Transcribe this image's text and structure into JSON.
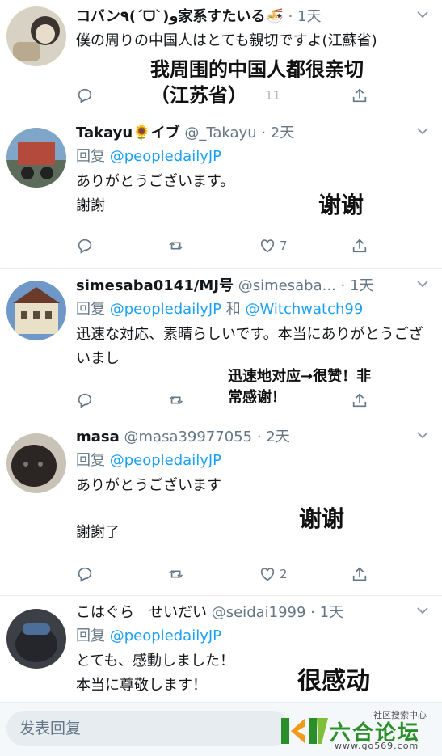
{
  "tweets": [
    {
      "name": "コバン٩(ˊᗜˋ)و家系すたいる🍜",
      "handle": "",
      "time": "1天",
      "reply_prefix": "",
      "reply_to": "",
      "text": "僕の周りの中国人はとても親切ですよ(江蘇省)",
      "counts": {
        "reply": "",
        "retweet": "",
        "like": "11"
      },
      "overlay": "我周围的中国人都很亲切（江苏省）"
    },
    {
      "name": "Takayu🌻イブ",
      "handle": "@_Takayu",
      "time": "2天",
      "reply_prefix": "回复 ",
      "reply_to": "@peopledailyJP",
      "text_lines": [
        "ありがとうございます。",
        "謝謝"
      ],
      "counts": {
        "reply": "",
        "retweet": "",
        "like": "7"
      },
      "overlay": "谢谢"
    },
    {
      "name": "simesaba0141/MJ号",
      "handle": "@simesaba...",
      "time": "1天",
      "reply_prefix": "回复 ",
      "reply_to": "@peopledailyJP",
      "reply_joiner": " 和 ",
      "reply_to_2": "@Witchwatch99",
      "text": "迅速な対応、素晴らしいです。本当にありがとうございまし",
      "counts": {
        "reply": "",
        "retweet": "",
        "like": ""
      },
      "overlay_line1": "迅速地对应→很赞！非",
      "overlay_line2": "常感谢！"
    },
    {
      "name": "masa",
      "handle": "@masa39977055",
      "time": "2天",
      "reply_prefix": "回复 ",
      "reply_to": "@peopledailyJP",
      "text_lines": [
        "ありがとうございます",
        "謝謝了"
      ],
      "counts": {
        "reply": "",
        "retweet": "",
        "like": "2"
      },
      "overlay": "谢谢"
    },
    {
      "name": "こはぐら　せいだい",
      "handle": "@seidai1999",
      "time": "1天",
      "reply_prefix": "回复 ",
      "reply_to": "@peopledailyJP",
      "text_lines": [
        "とても、感動しました！",
        "本当に尊敬します！"
      ],
      "overlay": "很感动"
    }
  ],
  "composer": {
    "placeholder": "发表回复"
  },
  "watermark": {
    "top": "社区搜索中心",
    "main": "六合论坛",
    "url": "www.go569.com"
  },
  "colors": {
    "link": "#1da1f2",
    "muted": "#657786",
    "text": "#14171a",
    "watermark_green": "#2a8f2a"
  },
  "icons": [
    "reply-icon",
    "retweet-icon",
    "like-icon",
    "share-icon",
    "chevron-down-icon"
  ]
}
